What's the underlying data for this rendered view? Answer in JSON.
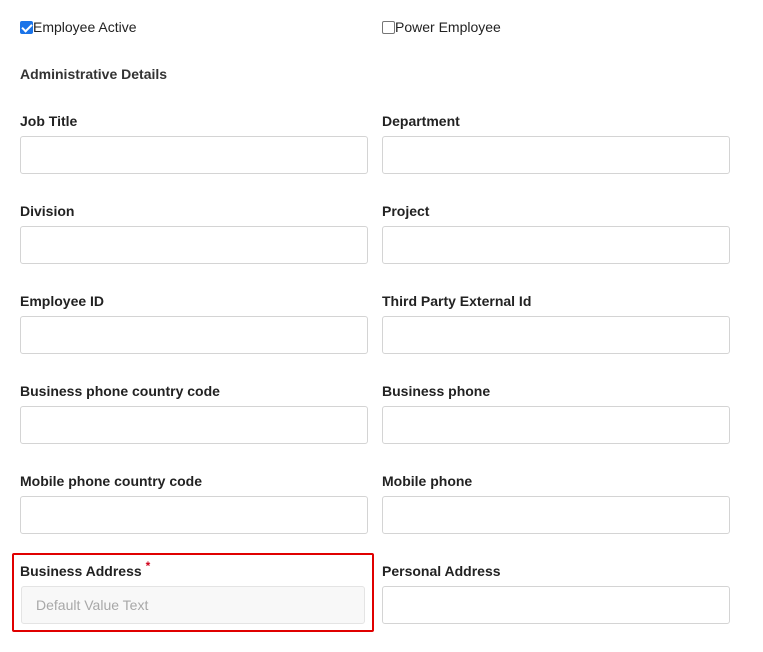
{
  "checkboxes": {
    "employee_active": {
      "label": "Employee Active",
      "checked": true
    },
    "power_employee": {
      "label": "Power Employee",
      "checked": false
    }
  },
  "section": {
    "title": "Administrative Details"
  },
  "fields": {
    "job_title": {
      "label": "Job Title",
      "value": ""
    },
    "department": {
      "label": "Department",
      "value": ""
    },
    "division": {
      "label": "Division",
      "value": ""
    },
    "project": {
      "label": "Project",
      "value": ""
    },
    "employee_id": {
      "label": "Employee ID",
      "value": ""
    },
    "third_party_external_id": {
      "label": "Third Party External Id",
      "value": ""
    },
    "business_phone_country_code": {
      "label": "Business phone country code",
      "value": ""
    },
    "business_phone": {
      "label": "Business phone",
      "value": ""
    },
    "mobile_phone_country_code": {
      "label": "Mobile phone country code",
      "value": ""
    },
    "mobile_phone": {
      "label": "Mobile phone",
      "value": ""
    },
    "business_address": {
      "label": "Business Address",
      "required_marker": "*",
      "placeholder": "Default Value Text",
      "value": ""
    },
    "personal_address": {
      "label": "Personal Address",
      "value": ""
    }
  },
  "colors": {
    "checkbox_accent": "#1a73e8",
    "required_marker": "#d0021b",
    "highlight_border": "#e00000",
    "input_border": "#d4d4d4"
  }
}
